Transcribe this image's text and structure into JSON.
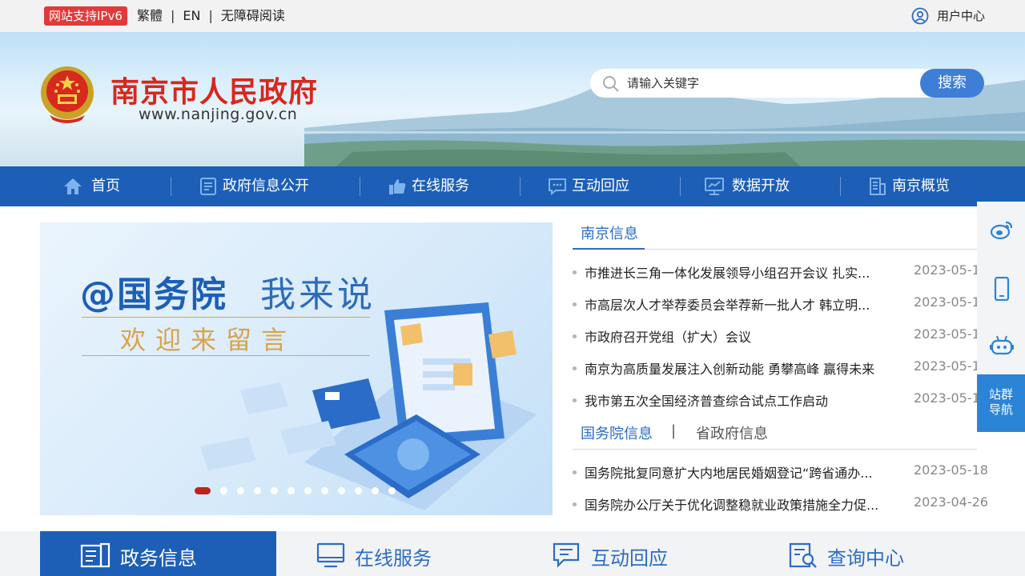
{
  "topbar": {
    "ipv6_badge": "网站支持IPv6",
    "links": [
      "繁體",
      "EN",
      "无障碍阅读"
    ],
    "separator": "|",
    "user_center": "用户中心"
  },
  "header": {
    "site_name": "南京市人民政府",
    "site_url": "www.nanjing.gov.cn",
    "search_placeholder": "请输入关键字",
    "search_button": "搜索"
  },
  "nav": {
    "items": [
      {
        "label": "首页",
        "icon": "home-icon"
      },
      {
        "label": "政府信息公开",
        "icon": "document-icon"
      },
      {
        "label": "在线服务",
        "icon": "thumbs-up-icon"
      },
      {
        "label": "互动回应",
        "icon": "chat-icon"
      },
      {
        "label": "数据开放",
        "icon": "monitor-chart-icon"
      },
      {
        "label": "南京概览",
        "icon": "building-icon"
      }
    ]
  },
  "banner": {
    "title_part1": "@国务院",
    "title_part2": "我来说",
    "subtitle": "欢迎来留言",
    "slide_count": 12,
    "active_slide": 1
  },
  "news": {
    "tab_nanjing": "南京信息",
    "items_nanjing": [
      {
        "title": "市推进长三角一体化发展领导小组召开会议 扎实...",
        "date": "2023-05-1"
      },
      {
        "title": "市高层次人才举荐委员会举荐新一批人才 韩立明...",
        "date": "2023-05-1"
      },
      {
        "title": "市政府召开党组（扩大）会议",
        "date": "2023-05-1"
      },
      {
        "title": "南京为高质量发展注入创新动能 勇攀高峰 赢得未来",
        "date": "2023-05-1"
      },
      {
        "title": "我市第五次全国经济普查综合试点工作启动",
        "date": "2023-05-1"
      }
    ],
    "tab_state_council": "国务院信息",
    "tab_separator": "|",
    "tab_province": "省政府信息",
    "items_state_council": [
      {
        "title": "国务院批复同意扩大内地居民婚姻登记“跨省通办...",
        "date": "2023-05-18"
      },
      {
        "title": "国务院办公厅关于优化调整稳就业政策措施全力促...",
        "date": "2023-04-26"
      }
    ]
  },
  "sidebar": {
    "buttons": [
      "weibo-icon",
      "mobile-icon",
      "robot-icon"
    ],
    "site_nav": "站群导航"
  },
  "bottom_tabs": [
    {
      "label": "政务信息",
      "icon": "news-icon",
      "active": true
    },
    {
      "label": "在线服务",
      "icon": "computer-icon",
      "active": false
    },
    {
      "label": "互动回应",
      "icon": "message-icon",
      "active": false
    },
    {
      "label": "查询中心",
      "icon": "search-doc-icon",
      "active": false
    }
  ],
  "colors": {
    "brand_blue": "#1d5fb6",
    "accent_red": "#d9261c",
    "link_blue": "#2b6cc4"
  }
}
